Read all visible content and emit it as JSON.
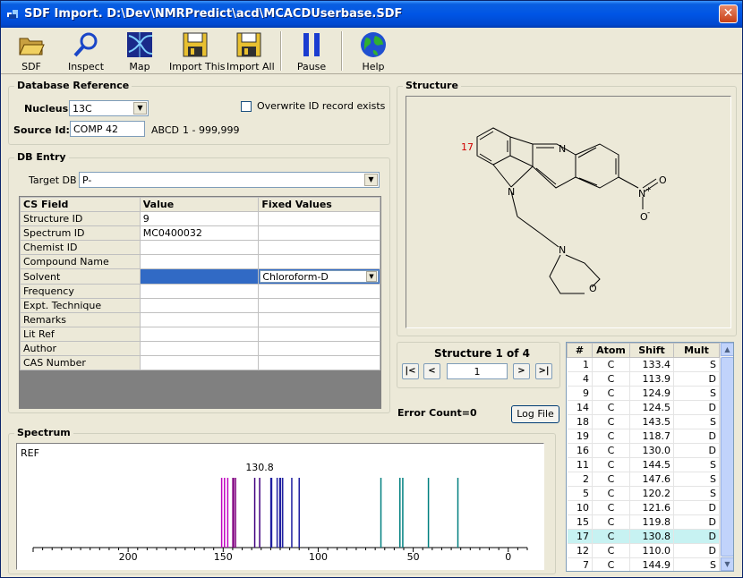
{
  "window": {
    "title": "SDF Import. D:\\Dev\\NMRPredict\\acd\\MCACDUserbase.SDF",
    "close": "✕"
  },
  "toolbar": {
    "sdf": "SDF",
    "inspect": "Inspect",
    "map": "Map",
    "import_this": "Import This",
    "import_all": "Import All",
    "pause": "Pause",
    "help": "Help"
  },
  "db_reference": {
    "legend": "Database Reference",
    "nucleus_label": "Nucleus",
    "nucleus_value": "13C",
    "overwrite_label": "Overwrite ID record exists",
    "overwrite_checked": false,
    "source_label": "Source Id:",
    "source_value": "COMP 42",
    "source_hint": "ABCD",
    "source_range": "1 - 999,999"
  },
  "db_entry": {
    "legend": "DB Entry",
    "target_label": "Target DB",
    "target_value": "P-",
    "columns": [
      "CS Field",
      "Value",
      "Fixed Values"
    ],
    "rows": [
      {
        "field": "Structure ID",
        "value": "9",
        "fixed": ""
      },
      {
        "field": "Spectrum ID",
        "value": "MC0400032",
        "fixed": ""
      },
      {
        "field": "Chemist ID",
        "value": "",
        "fixed": ""
      },
      {
        "field": "Compound Name",
        "value": "",
        "fixed": ""
      },
      {
        "field": "Solvent",
        "value": "",
        "fixed": "Chloroform-D"
      },
      {
        "field": "Frequency",
        "value": "",
        "fixed": ""
      },
      {
        "field": "Expt. Technique",
        "value": "",
        "fixed": ""
      },
      {
        "field": "Remarks",
        "value": "",
        "fixed": ""
      },
      {
        "field": "Lit Ref",
        "value": "",
        "fixed": ""
      },
      {
        "field": "Author",
        "value": "",
        "fixed": ""
      },
      {
        "field": "CAS Number",
        "value": "",
        "fixed": ""
      }
    ]
  },
  "structure": {
    "legend": "Structure",
    "atom_label": "17",
    "atoms": {
      "n": "N",
      "o": "O",
      "o_minus": "O",
      "minus": "-",
      "plus": "+"
    },
    "nav_title": "Structure 1 of 4",
    "nav_value": "1",
    "nav_first": "|<",
    "nav_prev": "<",
    "nav_next": ">",
    "nav_last": ">|"
  },
  "error_count": "Error Count=0",
  "log_file_label": "Log File",
  "shifts": {
    "columns": [
      "#",
      "Atom",
      "Shift",
      "Mult"
    ],
    "highlight_row": 12,
    "rows": [
      {
        "n": "1",
        "atom": "C",
        "shift": "133.4",
        "mult": "S"
      },
      {
        "n": "4",
        "atom": "C",
        "shift": "113.9",
        "mult": "D"
      },
      {
        "n": "9",
        "atom": "C",
        "shift": "124.9",
        "mult": "S"
      },
      {
        "n": "14",
        "atom": "C",
        "shift": "124.5",
        "mult": "D"
      },
      {
        "n": "18",
        "atom": "C",
        "shift": "143.5",
        "mult": "S"
      },
      {
        "n": "19",
        "atom": "C",
        "shift": "118.7",
        "mult": "D"
      },
      {
        "n": "16",
        "atom": "C",
        "shift": "130.0",
        "mult": "D"
      },
      {
        "n": "11",
        "atom": "C",
        "shift": "144.5",
        "mult": "S"
      },
      {
        "n": "2",
        "atom": "C",
        "shift": "147.6",
        "mult": "S"
      },
      {
        "n": "5",
        "atom": "C",
        "shift": "120.2",
        "mult": "S"
      },
      {
        "n": "10",
        "atom": "C",
        "shift": "121.6",
        "mult": "D"
      },
      {
        "n": "15",
        "atom": "C",
        "shift": "119.8",
        "mult": "D"
      },
      {
        "n": "17",
        "atom": "C",
        "shift": "130.8",
        "mult": "D"
      },
      {
        "n": "12",
        "atom": "C",
        "shift": "110.0",
        "mult": "D"
      },
      {
        "n": "7",
        "atom": "C",
        "shift": "144.9",
        "mult": "S"
      }
    ]
  },
  "spectrum": {
    "legend": "Spectrum",
    "ref_label": "REF",
    "peak_label": "130.8",
    "axis_ticks": [
      "200",
      "150",
      "100",
      "50",
      "0"
    ],
    "axis_range": [
      250,
      -10
    ],
    "peaks": [
      {
        "ppm": 150.8,
        "color": "#c000c0"
      },
      {
        "ppm": 149.3,
        "color": "#c000c0"
      },
      {
        "ppm": 147.6,
        "color": "#c000c0"
      },
      {
        "ppm": 144.9,
        "color": "#800080"
      },
      {
        "ppm": 144.5,
        "color": "#800080"
      },
      {
        "ppm": 143.5,
        "color": "#800080"
      },
      {
        "ppm": 133.4,
        "color": "#400080"
      },
      {
        "ppm": 130.8,
        "color": "#400080"
      },
      {
        "ppm": 124.9,
        "color": "#2020a0"
      },
      {
        "ppm": 124.5,
        "color": "#2020a0"
      },
      {
        "ppm": 121.6,
        "color": "#2020a0"
      },
      {
        "ppm": 120.2,
        "color": "#2020a0"
      },
      {
        "ppm": 119.8,
        "color": "#2020a0"
      },
      {
        "ppm": 118.7,
        "color": "#2020a0"
      },
      {
        "ppm": 113.9,
        "color": "#2020a0"
      },
      {
        "ppm": 110.0,
        "color": "#2020a0"
      },
      {
        "ppm": 67.0,
        "color": "#008080"
      },
      {
        "ppm": 57.0,
        "color": "#008080"
      },
      {
        "ppm": 55.5,
        "color": "#008080"
      },
      {
        "ppm": 42.0,
        "color": "#008080"
      },
      {
        "ppm": 26.5,
        "color": "#008080"
      }
    ]
  }
}
